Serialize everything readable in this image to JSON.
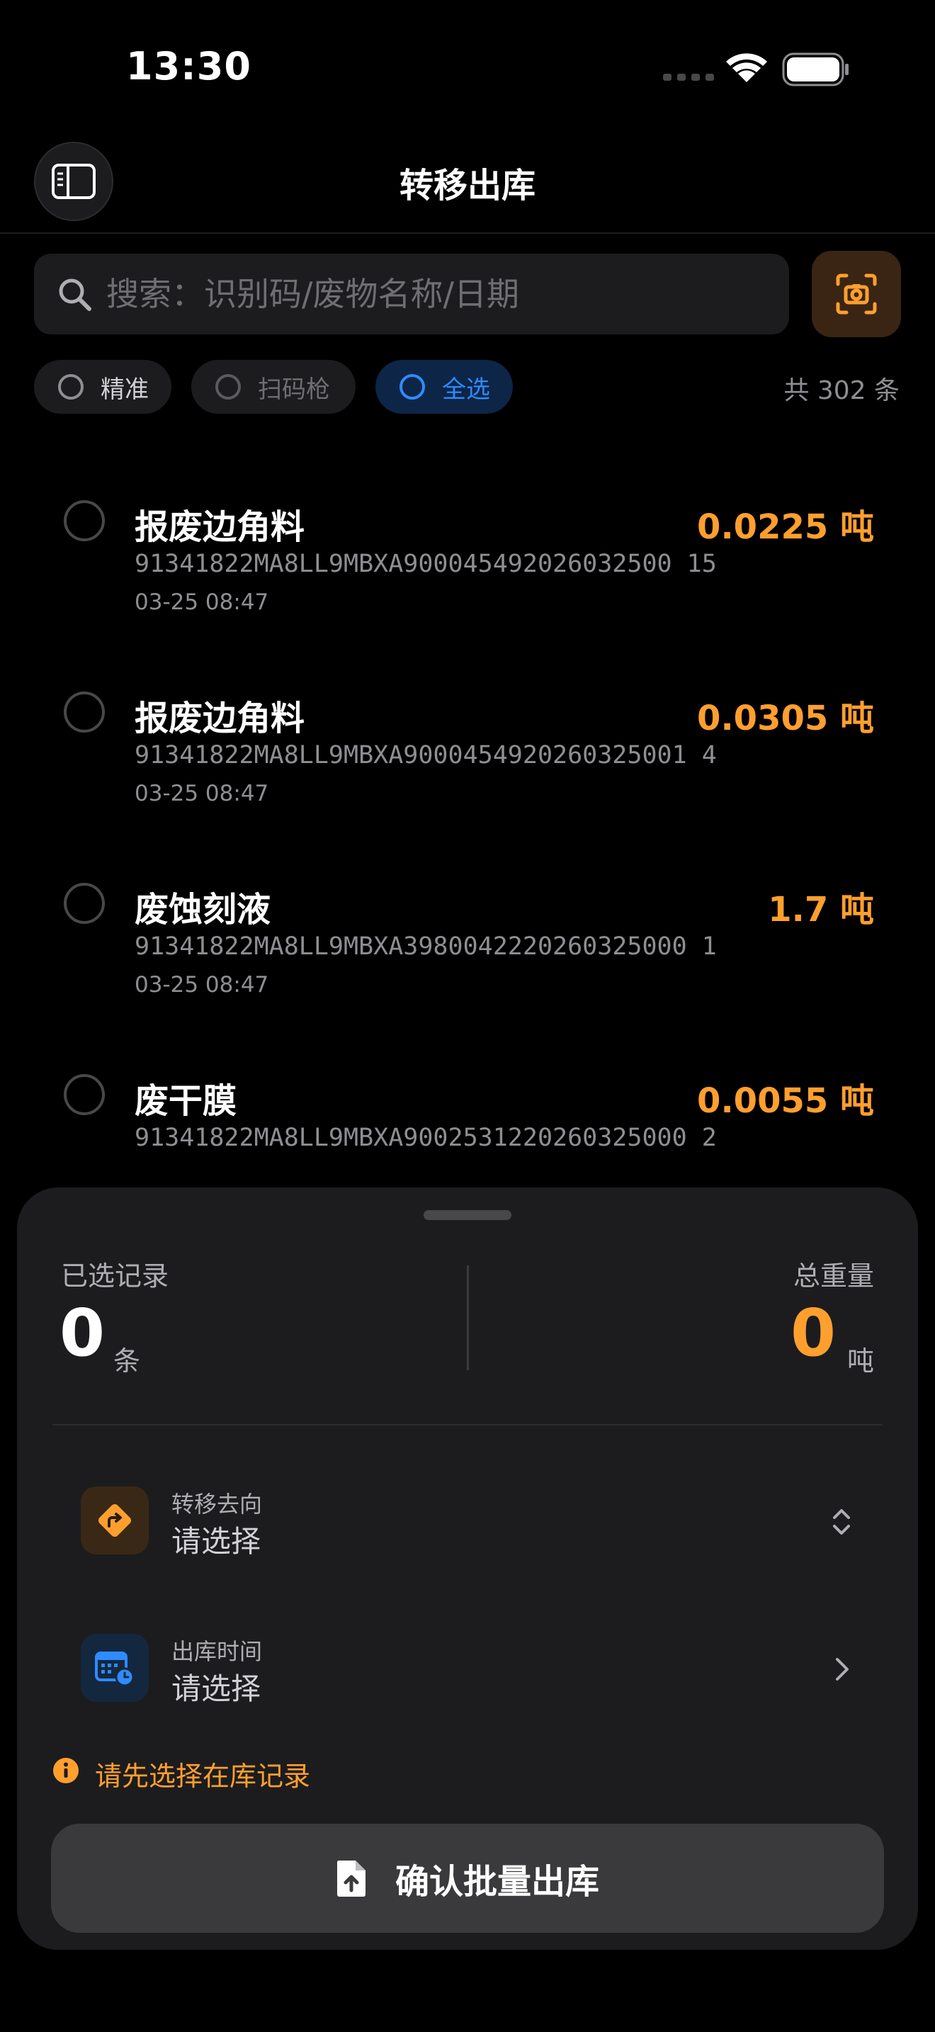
{
  "status_bar": {
    "time": "13:30"
  },
  "nav": {
    "title": "转移出库",
    "sidebar_icon": "sidebar-icon"
  },
  "search": {
    "placeholder": "搜索：识别码/废物名称/日期",
    "value": "",
    "scan_icon": "camera-scan-icon"
  },
  "filters": {
    "chips": [
      {
        "label": "精准",
        "state": "unselected"
      },
      {
        "label": "扫码枪",
        "state": "disabled"
      },
      {
        "label": "全选",
        "state": "highlighted"
      }
    ],
    "count_text": "共 302 条"
  },
  "records": [
    {
      "name": "报废边角料",
      "weight": "0.0225 吨",
      "code": "91341822MA8LL9MBXA900045492026032500 15",
      "date": "03-25 08:47"
    },
    {
      "name": "报废边角料",
      "weight": "0.0305 吨",
      "code": "91341822MA8LL9MBXA9000454920260325001 4",
      "date": "03-25 08:47"
    },
    {
      "name": "废蚀刻液",
      "weight": "1.7 吨",
      "code": "91341822MA8LL9MBXA3980042220260325000 1",
      "date": "03-25 08:47"
    },
    {
      "name": "废干膜",
      "weight": "0.0055 吨",
      "code": "91341822MA8LL9MBXA9002531220260325000 2",
      "date": ""
    }
  ],
  "summary": {
    "selected_label": "已选记录",
    "selected_value": "0",
    "selected_unit": "条",
    "weight_label": "总重量",
    "weight_value": "0",
    "weight_unit": "吨"
  },
  "form": {
    "destination": {
      "label": "转移去向",
      "value": "请选择",
      "icon": "route-direction-icon"
    },
    "time": {
      "label": "出库时间",
      "value": "请选择",
      "icon": "calendar-clock-icon"
    }
  },
  "warning": "请先选择在库记录",
  "confirm_label": "确认批量出库",
  "colors": {
    "accent_orange": "#ff9f2e",
    "accent_blue": "#2f8bff",
    "sheet_bg": "#1c1c1e"
  }
}
